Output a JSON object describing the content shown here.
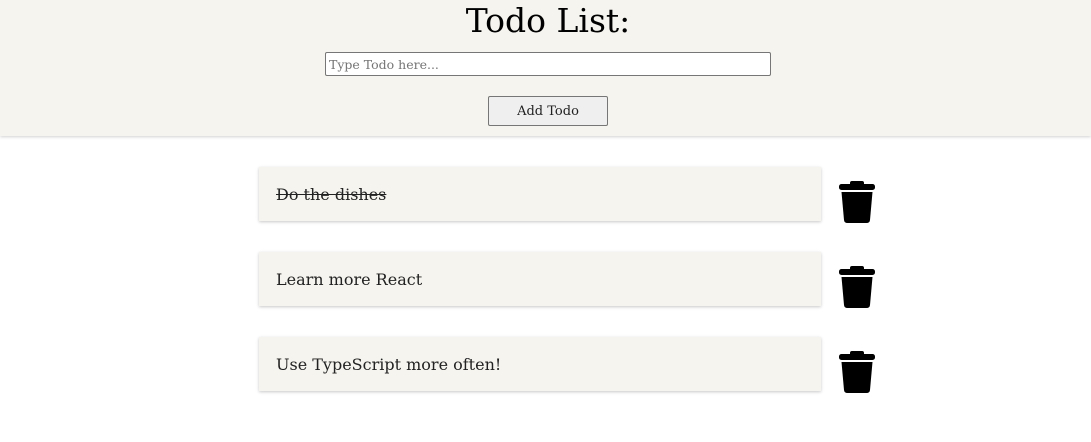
{
  "header": {
    "title": "Todo List:",
    "input_placeholder": "Type Todo here...",
    "input_value": "",
    "add_button_label": "Add Todo"
  },
  "todos": [
    {
      "text": "Do the dishes",
      "completed": true,
      "delete_icon": "trash-icon"
    },
    {
      "text": "Learn more React",
      "completed": false,
      "delete_icon": "trash-icon"
    },
    {
      "text": "Use TypeScript more often!",
      "completed": false,
      "delete_icon": "trash-icon"
    }
  ],
  "colors": {
    "panel_background": "#f5f4ef",
    "text": "#222222",
    "icon": "#000000"
  }
}
